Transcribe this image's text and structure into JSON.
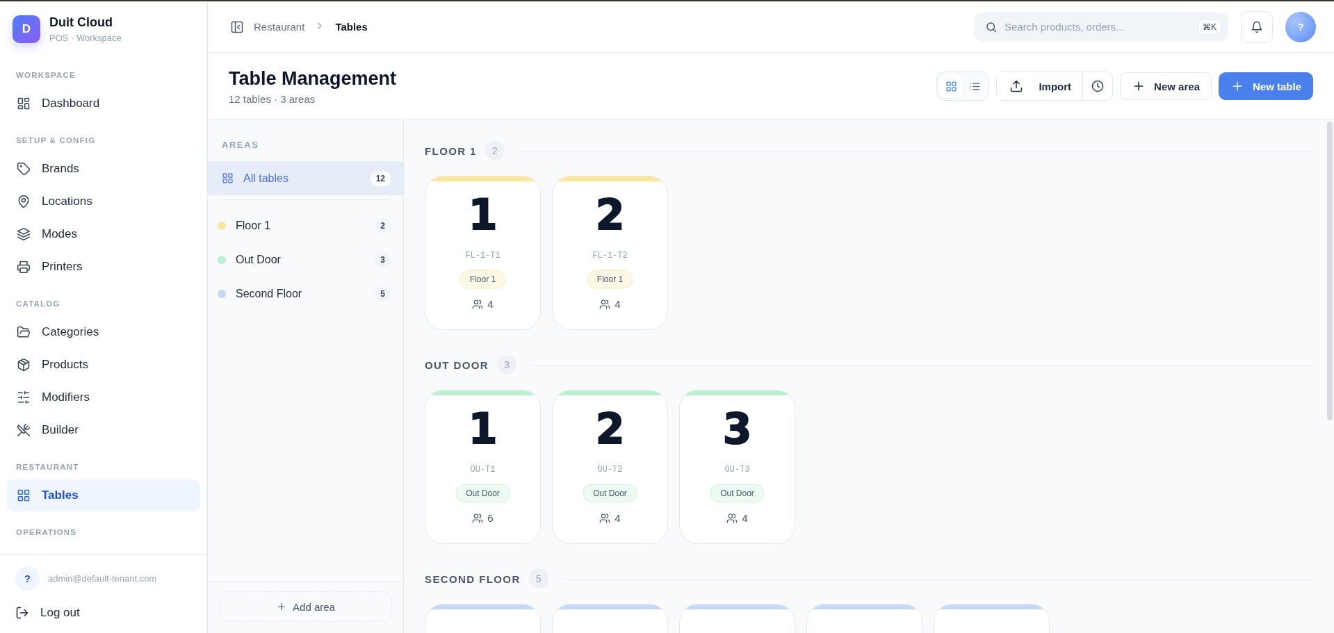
{
  "brand": {
    "logo": "D",
    "name": "Duit Cloud",
    "subtitle": "POS · Workspace"
  },
  "sidebar": {
    "sections": [
      {
        "heading": "WORKSPACE",
        "items": [
          {
            "label": "Dashboard",
            "kind": "dashboard",
            "selected": false
          }
        ]
      },
      {
        "heading": "SETUP & CONFIG",
        "items": [
          {
            "label": "Brands",
            "kind": "tag",
            "selected": false
          },
          {
            "label": "Locations",
            "kind": "pin",
            "selected": false
          },
          {
            "label": "Modes",
            "kind": "layers",
            "selected": false
          },
          {
            "label": "Printers",
            "kind": "printer",
            "selected": false
          }
        ]
      },
      {
        "heading": "CATALOG",
        "items": [
          {
            "label": "Categories",
            "kind": "folder",
            "selected": false
          },
          {
            "label": "Products",
            "kind": "box",
            "selected": false
          },
          {
            "label": "Modifiers",
            "kind": "sliders",
            "selected": false
          },
          {
            "label": "Builder",
            "kind": "utensils",
            "selected": false
          }
        ]
      },
      {
        "heading": "RESTAURANT",
        "items": [
          {
            "label": "Tables",
            "kind": "grid",
            "selected": true
          }
        ]
      },
      {
        "heading": "OPERATIONS"
      }
    ],
    "user": {
      "avatar": "?",
      "email": "admin@default-tenant.com"
    },
    "logout": "Log out"
  },
  "breadcrumb": [
    "Restaurant",
    "Tables"
  ],
  "search": {
    "placeholder": "Search products, orders...",
    "shortcut": "⌘K"
  },
  "avatar": "?",
  "page": {
    "title": "Table Management",
    "subtitle": "12 tables · 3 areas"
  },
  "view_toggle": [
    {
      "kind": "grid",
      "selected": true
    },
    {
      "kind": "list",
      "selected": false
    }
  ],
  "actions": {
    "import": "Import",
    "new_area": "New area",
    "new_table": "New table"
  },
  "areas": {
    "heading": "AREAS",
    "items": [
      {
        "kind": "all",
        "label": "All tables",
        "count": "12",
        "selected": true
      },
      {
        "kind": "area",
        "label": "Floor 1",
        "count": "2",
        "color": "#fbe6a0",
        "selected": false
      },
      {
        "kind": "area",
        "label": "Out Door",
        "count": "3",
        "color": "#bcefd1",
        "selected": false
      },
      {
        "kind": "area",
        "label": "Second Floor",
        "count": "5",
        "color": "#c6d8f7",
        "selected": false
      }
    ],
    "add": "Add area"
  },
  "sections": [
    {
      "name": "FLOOR 1",
      "count": "2",
      "color": "#fbe6a0",
      "tables": [
        {
          "kind": "card",
          "number": "1",
          "code": "FL-1-T1",
          "area": "Floor 1",
          "seats": "4"
        },
        {
          "kind": "card",
          "number": "2",
          "code": "FL-1-T2",
          "area": "Floor 1",
          "seats": "4"
        }
      ]
    },
    {
      "name": "OUT DOOR",
      "count": "3",
      "color": "#bcefd1",
      "tables": [
        {
          "kind": "card",
          "number": "1",
          "code": "OU-T1",
          "area": "Out Door",
          "seats": "6"
        },
        {
          "kind": "card",
          "number": "2",
          "code": "OU-T2",
          "area": "Out Door",
          "seats": "4"
        },
        {
          "kind": "card",
          "number": "3",
          "code": "OU-T3",
          "area": "Out Door",
          "seats": "4"
        }
      ]
    },
    {
      "name": "SECOND FLOOR",
      "count": "5",
      "color": "#c6d8f7",
      "tables": [
        {
          "kind": "cut"
        },
        {
          "kind": "cut"
        },
        {
          "kind": "cut"
        },
        {
          "kind": "cut"
        },
        {
          "kind": "cut"
        }
      ]
    }
  ]
}
